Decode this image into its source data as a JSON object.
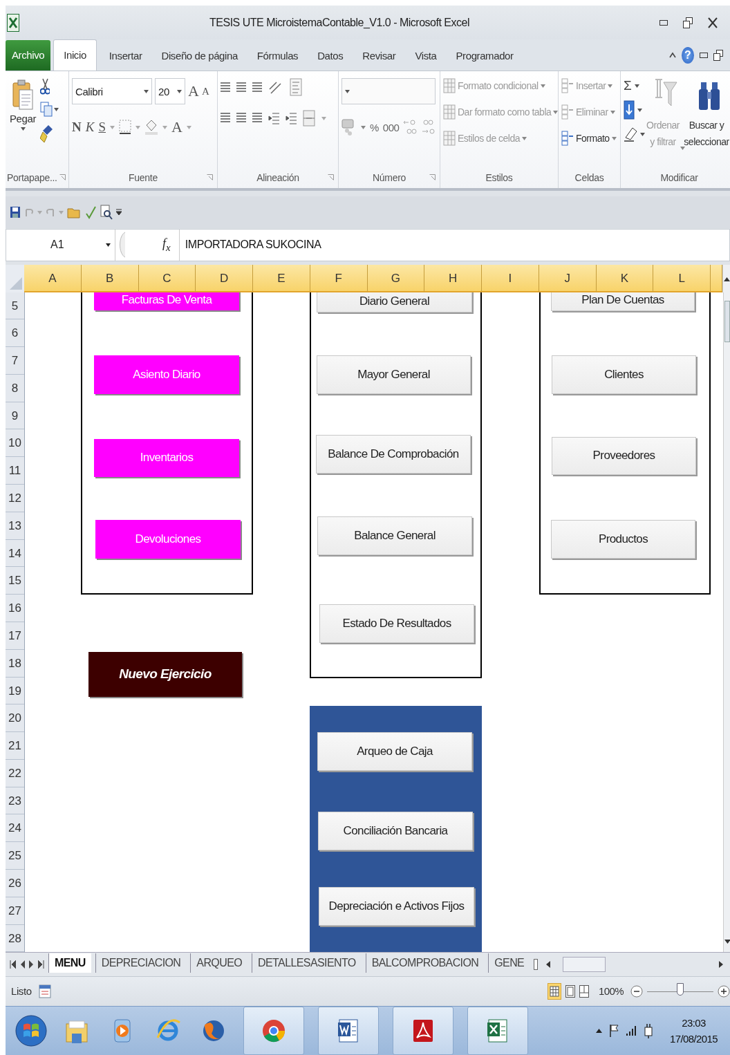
{
  "window": {
    "title": "TESIS UTE MicroistemaContable_V1.0  -  Microsoft Excel"
  },
  "ribbon_tabs": [
    {
      "label": "Archivo",
      "kind": "file",
      "selected": false
    },
    {
      "label": "Inicio",
      "kind": "tab",
      "selected": true
    },
    {
      "label": "Insertar",
      "kind": "tab",
      "selected": false
    },
    {
      "label": "Diseño de página",
      "kind": "tab",
      "selected": false
    },
    {
      "label": "Fórmulas",
      "kind": "tab",
      "selected": false
    },
    {
      "label": "Datos",
      "kind": "tab",
      "selected": false
    },
    {
      "label": "Revisar",
      "kind": "tab",
      "selected": false
    },
    {
      "label": "Vista",
      "kind": "tab",
      "selected": false
    },
    {
      "label": "Programador",
      "kind": "tab",
      "selected": false
    }
  ],
  "help_button": "?",
  "ribbon": {
    "groups": [
      {
        "label": "Portapape...",
        "paste": "Pegar"
      },
      {
        "label": "Fuente",
        "font_name": "Calibri",
        "font_size": "20",
        "grow": "A",
        "shrink": "A",
        "bold": "N",
        "italic": "K",
        "underline": "S",
        "font_color": "A"
      },
      {
        "label": "Alineación"
      },
      {
        "label": "Número",
        "percent": "%",
        "thousands": "000"
      },
      {
        "label": "Estilos",
        "commands": [
          {
            "label": "Formato condicional",
            "disabled": true
          },
          {
            "label": "Dar formato como tabla",
            "disabled": true
          },
          {
            "label": "Estilos de celda",
            "disabled": true
          }
        ]
      },
      {
        "label": "Celdas",
        "commands": [
          {
            "label": "Insertar",
            "disabled": true
          },
          {
            "label": "Eliminar",
            "disabled": true
          },
          {
            "label": "Formato",
            "disabled": false
          }
        ]
      },
      {
        "label": "Modificar",
        "sum": "Σ",
        "commands": [
          {
            "label": "Ordenar y filtrar",
            "disabled": true
          },
          {
            "label": "Buscar y seleccionar",
            "disabled": false
          }
        ]
      }
    ]
  },
  "formula_bar": {
    "name_box": "A1",
    "fx": "f$_{x}$",
    "value": "IMPORTADORA SUKOCINA"
  },
  "columns": [
    "A",
    "B",
    "C",
    "D",
    "E",
    "F",
    "G",
    "H",
    "I",
    "J",
    "K",
    "L"
  ],
  "rows": [
    "5",
    "6",
    "7",
    "8",
    "9",
    "10",
    "11",
    "12",
    "13",
    "14",
    "15",
    "16",
    "17",
    "18",
    "19",
    "20",
    "21",
    "22",
    "23",
    "24",
    "25",
    "26",
    "27",
    "28"
  ],
  "sheet_buttons": [
    {
      "label": "Facturas De Venta",
      "kind": "pink"
    },
    {
      "label": "Asiento Diario",
      "kind": "pink"
    },
    {
      "label": "Inventarios",
      "kind": "pink"
    },
    {
      "label": "Devoluciones",
      "kind": "pink"
    },
    {
      "label": "Nuevo Ejercicio",
      "kind": "dark"
    },
    {
      "label": "Diario General",
      "kind": "plain"
    },
    {
      "label": "Mayor General",
      "kind": "plain"
    },
    {
      "label": "Balance De Comprobación",
      "kind": "plain"
    },
    {
      "label": "Balance General",
      "kind": "plain"
    },
    {
      "label": "Estado De Resultados",
      "kind": "plain"
    },
    {
      "label": "Arqueo de Caja",
      "kind": "plain"
    },
    {
      "label": "Conciliación Bancaria",
      "kind": "plain"
    },
    {
      "label": "Depreciación e Activos Fijos",
      "kind": "plain"
    },
    {
      "label": "Plan De Cuentas",
      "kind": "plain"
    },
    {
      "label": "Clientes",
      "kind": "plain"
    },
    {
      "label": "Proveedores",
      "kind": "plain"
    },
    {
      "label": "Productos",
      "kind": "plain"
    }
  ],
  "sheet_tabs": [
    {
      "label": "MENU",
      "selected": true
    },
    {
      "label": "DEPRECIACION",
      "selected": false
    },
    {
      "label": "ARQUEO",
      "selected": false
    },
    {
      "label": "DETALLESASIENTO",
      "selected": false
    },
    {
      "label": "BALCOMPROBACION",
      "selected": false
    },
    {
      "label": "GENE",
      "selected": false
    }
  ],
  "status_bar": {
    "status": "Listo",
    "zoom": "100%",
    "zoom_slider": {
      "level": 0.5
    }
  },
  "taskbar": {
    "apps": [
      {
        "running": false
      },
      {
        "running": false
      },
      {
        "running": false
      },
      {
        "running": false
      },
      {
        "running": true
      },
      {
        "running": true
      },
      {
        "running": true
      },
      {
        "running": true
      }
    ],
    "time": "23:03",
    "date": "17/08/2015"
  }
}
